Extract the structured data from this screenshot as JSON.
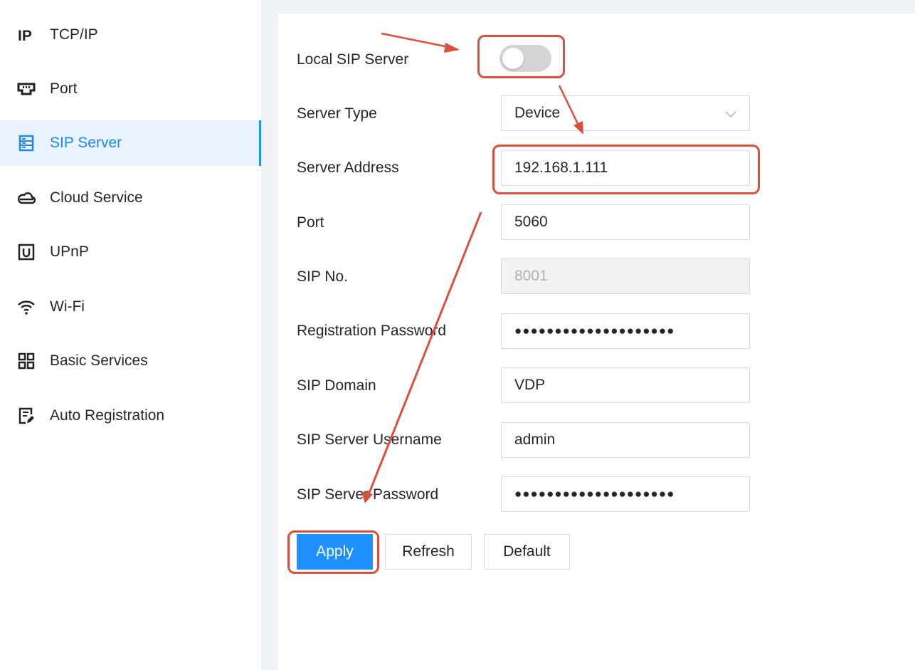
{
  "sidebar": {
    "items": [
      {
        "label": "TCP/IP",
        "icon": "ip-icon"
      },
      {
        "label": "Port",
        "icon": "port-icon"
      },
      {
        "label": "SIP Server",
        "icon": "server-icon",
        "active": true
      },
      {
        "label": "Cloud Service",
        "icon": "cloud-icon"
      },
      {
        "label": "UPnP",
        "icon": "upnp-icon"
      },
      {
        "label": "Wi-Fi",
        "icon": "wifi-icon"
      },
      {
        "label": "Basic Services",
        "icon": "grid-icon"
      },
      {
        "label": "Auto Registration",
        "icon": "edit-document-icon"
      }
    ]
  },
  "form": {
    "local_sip_server": {
      "label": "Local SIP Server",
      "enabled": false
    },
    "server_type": {
      "label": "Server Type",
      "value": "Device"
    },
    "server_address": {
      "label": "Server Address",
      "value": "192.168.1.111"
    },
    "port": {
      "label": "Port",
      "value": "5060"
    },
    "sip_no": {
      "label": "SIP No.",
      "value": "8001"
    },
    "registration_password": {
      "label": "Registration Password",
      "value": "●●●●●●●●●●●●●●●●●●●●"
    },
    "sip_domain": {
      "label": "SIP Domain",
      "value": "VDP"
    },
    "sip_server_username": {
      "label": "SIP Server Username",
      "value": "admin"
    },
    "sip_server_password": {
      "label": "SIP Server Password",
      "value": "●●●●●●●●●●●●●●●●●●●●"
    }
  },
  "buttons": {
    "apply": "Apply",
    "refresh": "Refresh",
    "default": "Default"
  },
  "colors": {
    "accent": "#1e90ff",
    "active_bg": "#e8f3ff",
    "annotation": "#d9503f"
  }
}
